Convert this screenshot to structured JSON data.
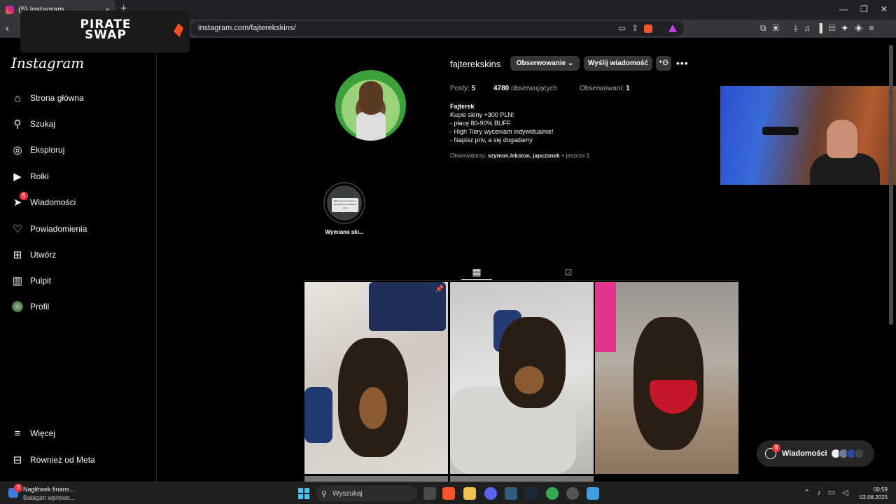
{
  "browser": {
    "tab_title": "(5) Instagram",
    "tab_close": "×",
    "new_tab": "+",
    "win_min": "—",
    "win_max": "❐",
    "win_close": "✕",
    "back": "‹",
    "url": "instagram.com/fajterekskins/"
  },
  "overlay": {
    "logo_line1": "PIRATE",
    "logo_line2": "SWAP"
  },
  "sidebar": {
    "logo": "Instagram",
    "items": [
      {
        "label": "Strona główna",
        "icon": "home-icon"
      },
      {
        "label": "Szukaj",
        "icon": "search-icon"
      },
      {
        "label": "Eksploruj",
        "icon": "compass-icon"
      },
      {
        "label": "Rolki",
        "icon": "reels-icon"
      },
      {
        "label": "Wiadomości",
        "icon": "messenger-icon",
        "badge": "5"
      },
      {
        "label": "Powiadomienia",
        "icon": "heart-icon"
      },
      {
        "label": "Utwórz",
        "icon": "plus-square-icon"
      },
      {
        "label": "Pulpit",
        "icon": "dashboard-icon"
      },
      {
        "label": "Profil",
        "icon": "avatar-icon"
      }
    ],
    "more": "Więcej",
    "meta": "Również od Meta"
  },
  "profile": {
    "username": "fajterekskins",
    "follow_button": "Obserwowanie",
    "message_button": "Wyślij wiadomość",
    "posts_label": "Posty:",
    "posts_count": "5",
    "followers_count": "4780",
    "followers_label": "obserwujących",
    "following_label": "Obserwowani:",
    "following_count": "1",
    "bio_name": "Fajterek",
    "bio_lines": [
      "Kupie skiny +300 PLN!",
      "- płacę 80-90% BUFF",
      "- High Tiery wyceniam indywidualnie!",
      "- Napisz priv, a się dogadamy"
    ],
    "followed_by_label": "Obserwatorzy:",
    "followed_by_names": "szymon.lekston, japczanek",
    "followed_by_more": "+ jeszcze 3"
  },
  "highlight": {
    "label": "Wymiana ski...",
    "card_line1": "Masz coś na wymianę ?",
    "card_line2": "Zapraszam do składania ofert!"
  },
  "messages_pill": {
    "label": "Wiadomości",
    "badge": "5"
  },
  "taskbar": {
    "news_title": "Nagłówek finans...",
    "news_sub": "Bałagan wprowa...",
    "news_badge": "2",
    "search_label": "Wyszukaj",
    "time": "00:59",
    "date": "02.08.2025"
  },
  "colors": {
    "accent_badge": "#ff3040",
    "background": "#000000",
    "button": "#363636"
  }
}
